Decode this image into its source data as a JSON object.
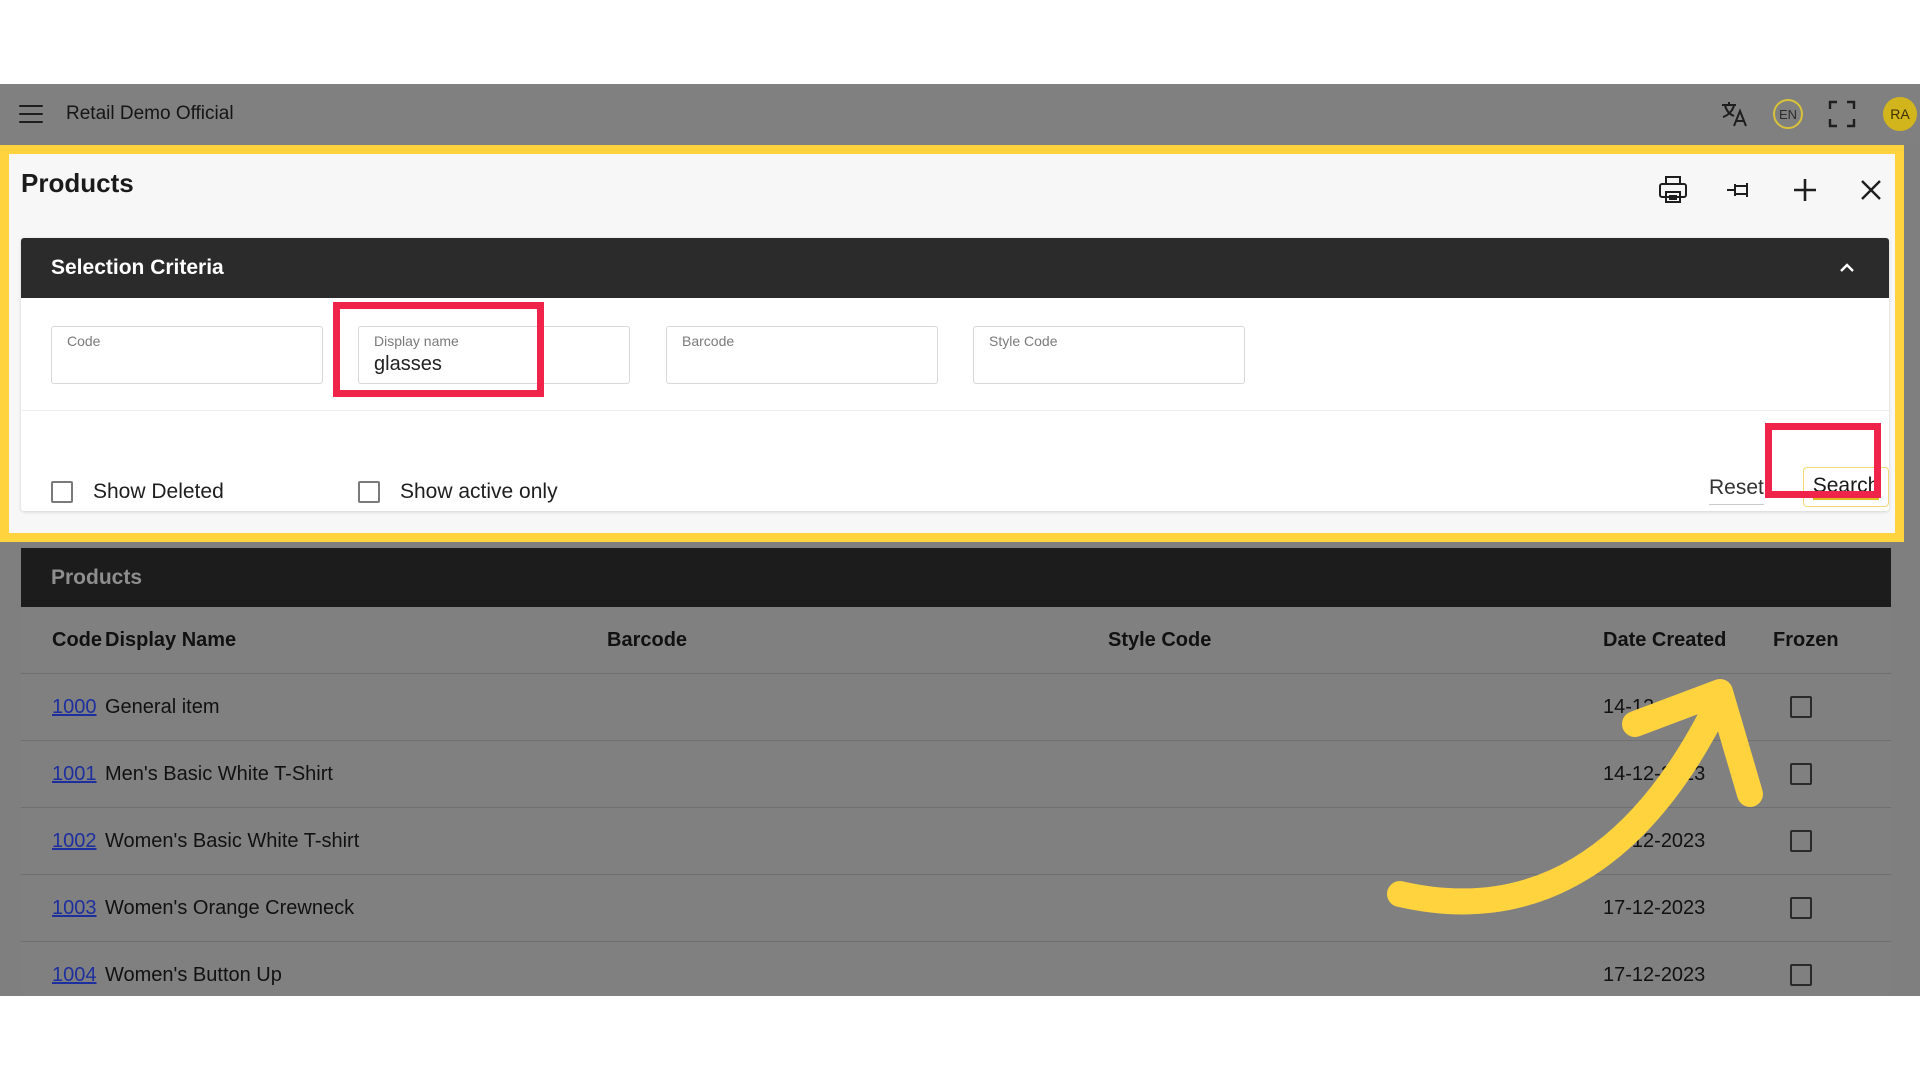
{
  "app": {
    "title": "Retail Demo Official",
    "language": "EN",
    "user_initials": "RA"
  },
  "panel": {
    "title": "Products"
  },
  "criteria": {
    "title": "Selection Criteria",
    "fields": [
      {
        "label": "Code",
        "value": ""
      },
      {
        "label": "Display name",
        "value": "glasses"
      },
      {
        "label": "Barcode",
        "value": ""
      },
      {
        "label": "Style Code",
        "value": ""
      }
    ],
    "show_deleted_label": "Show Deleted",
    "show_active_label": "Show active only",
    "reset_label": "Reset",
    "search_label": "Search"
  },
  "products": {
    "title": "Products",
    "columns": [
      "Code",
      "Display Name",
      "Barcode",
      "Style Code",
      "Date Created",
      "Frozen"
    ],
    "rows": [
      {
        "code": "1000",
        "name": "General item",
        "barcode": "",
        "style": "",
        "date": "14-12-2023"
      },
      {
        "code": "1001",
        "name": "Men's Basic White T-Shirt",
        "barcode": "",
        "style": "",
        "date": "14-12-2023"
      },
      {
        "code": "1002",
        "name": "Women's Basic White T-shirt",
        "barcode": "",
        "style": "",
        "date": "14-12-2023"
      },
      {
        "code": "1003",
        "name": "Women's Orange Crewneck",
        "barcode": "",
        "style": "",
        "date": "17-12-2023"
      },
      {
        "code": "1004",
        "name": "Women's Button Up",
        "barcode": "",
        "style": "",
        "date": "17-12-2023"
      }
    ]
  },
  "colors": {
    "highlight_yellow": "#ffd33d",
    "highlight_red": "#f0244a",
    "overlay_gray": "#7f7f7f"
  },
  "icons": [
    "menu-icon",
    "translate-icon",
    "fullscreen-icon",
    "print-icon",
    "pin-icon",
    "plus-icon",
    "close-icon",
    "chevron-up-icon",
    "curved-arrow-icon"
  ]
}
